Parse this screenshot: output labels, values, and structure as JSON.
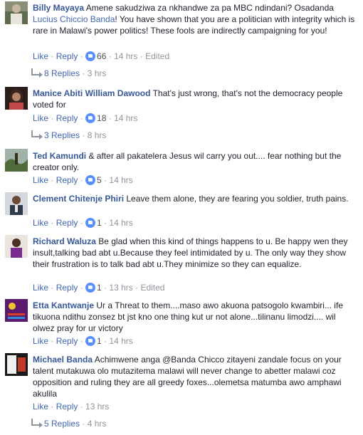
{
  "comments": [
    {
      "author": "Billy Mayaya",
      "text_a": " Amene sakudziwa za nkhandwe za pa MBC ndindani? Osadanda ",
      "mention": "Lucius Chiccio Banda",
      "text_b": "! You have shown that you are a politician with integrity which is rare in Malawi's power politics! These fools are indirectly campaigning for you!",
      "like": "Like",
      "reply": "Reply",
      "likes": "66",
      "time": "14 hrs",
      "edited": "Edited",
      "replies": "8 Replies",
      "replies_time": "3 hrs"
    },
    {
      "author": "Manice Abiti William Dawood",
      "text": " That's just wrong, that's not the democracy people voted for",
      "like": "Like",
      "reply": "Reply",
      "likes": "18",
      "time": "14 hrs",
      "replies": "3 Replies",
      "replies_time": "8 hrs"
    },
    {
      "author": "Ted Kamundi",
      "text": " & after all pakatelera Jesus wil carry you out.... fear nothing but the creator only.",
      "like": "Like",
      "reply": "Reply",
      "likes": "5",
      "time": "14 hrs"
    },
    {
      "author": "Clement Chitenje Phiri",
      "text": " Leave them alone, they are fearing you soldier, truth pains.",
      "like": "Like",
      "reply": "Reply",
      "likes": "1",
      "time": "14 hrs"
    },
    {
      "author": "Richard Waluza",
      "text": " Be glad when this kind of things happens to u. Be happy wen they insult,talking bad abt u.Because they feel intimidated by u. The only way they show their frustration is to talk bad abt u.They minimize so they can equalize.",
      "like": "Like",
      "reply": "Reply",
      "likes": "1",
      "time": "13 hrs",
      "edited": "Edited"
    },
    {
      "author": "Etta Kantwanje",
      "text": " Ur a Threat to them....maso awo akuona patsogolo kwambiri... ife tikuona ndithu zonsez bt jst kno one thing kut ur not alone...tilinanu limodzi.... wil olwez pray for ur victory",
      "like": "Like",
      "reply": "Reply",
      "likes": "1",
      "time": "14 hrs"
    },
    {
      "author": "Michael Banda",
      "text": " Achimwene anga @Banda Chicco zitayeni zandale focus on your talent mutakuwa olo mutazitema malawi will never change to abetter malawi coz opposition and ruling they are all greedy foxes...olemetsa matumba awo amphawi akulila",
      "like": "Like",
      "reply": "Reply",
      "time": "13 hrs",
      "replies": "5 Replies",
      "replies_time": "4 hrs"
    }
  ]
}
